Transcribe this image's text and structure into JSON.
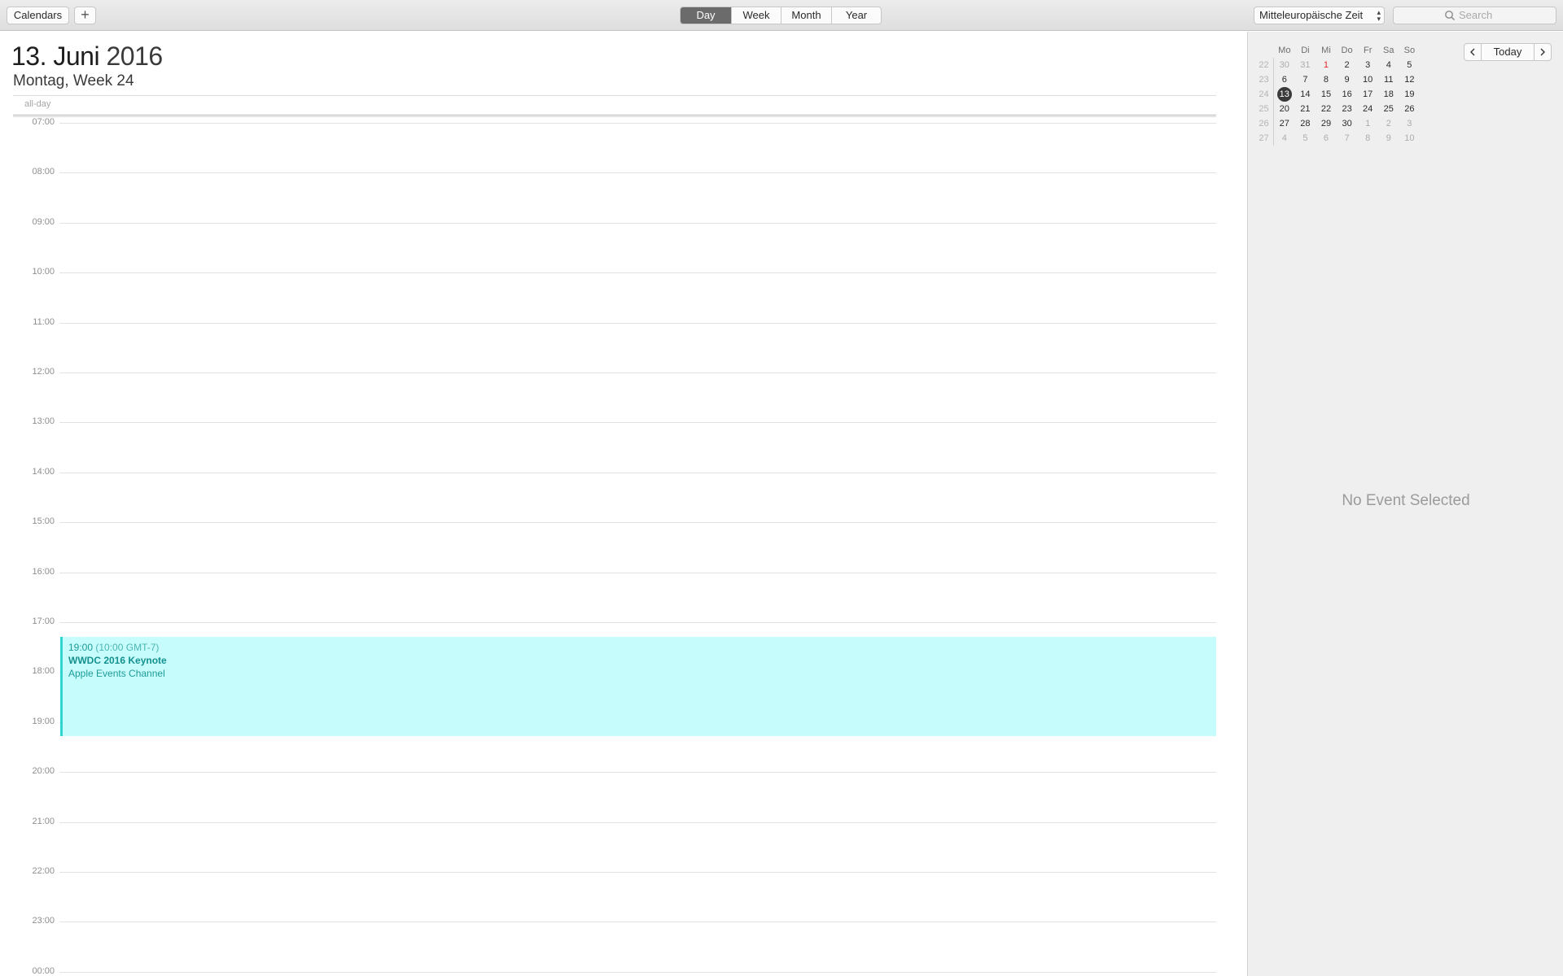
{
  "toolbar": {
    "calendars_label": "Calendars",
    "add_label": "+",
    "views": [
      "Day",
      "Week",
      "Month",
      "Year"
    ],
    "active_view": "Day",
    "timezone": "Mitteleuropäische Zeit",
    "search_placeholder": "Search"
  },
  "header": {
    "day_month": "13. Juni",
    "year": "2016",
    "subtitle": "Montag, Week 24",
    "allday_label": "all-day"
  },
  "hours": [
    "07:00",
    "08:00",
    "09:00",
    "10:00",
    "11:00",
    "12:00",
    "13:00",
    "14:00",
    "15:00",
    "16:00",
    "17:00",
    "18:00",
    "19:00",
    "20:00",
    "21:00",
    "22:00",
    "23:00",
    "00:00"
  ],
  "event": {
    "time": "19:00",
    "time_note": "(10:00 GMT-7)",
    "title": "WWDC 2016 Keynote",
    "location": "Apple Events Channel",
    "color": "#c6fdfc",
    "accent": "#2fd5ce"
  },
  "mini_calendar": {
    "weekdays": [
      "Mo",
      "Di",
      "Mi",
      "Do",
      "Fr",
      "Sa",
      "So"
    ],
    "weeks": [
      {
        "wk": "22",
        "days": [
          "30",
          "31",
          "1",
          "2",
          "3",
          "4",
          "5"
        ]
      },
      {
        "wk": "23",
        "days": [
          "6",
          "7",
          "8",
          "9",
          "10",
          "11",
          "12"
        ]
      },
      {
        "wk": "24",
        "days": [
          "13",
          "14",
          "15",
          "16",
          "17",
          "18",
          "19"
        ]
      },
      {
        "wk": "25",
        "days": [
          "20",
          "21",
          "22",
          "23",
          "24",
          "25",
          "26"
        ]
      },
      {
        "wk": "26",
        "days": [
          "27",
          "28",
          "29",
          "30",
          "1",
          "2",
          "3"
        ]
      },
      {
        "wk": "27",
        "days": [
          "4",
          "5",
          "6",
          "7",
          "8",
          "9",
          "10"
        ]
      }
    ],
    "selected_day": "13",
    "today_button": "Today"
  },
  "inspector": {
    "empty_text": "No Event Selected"
  }
}
